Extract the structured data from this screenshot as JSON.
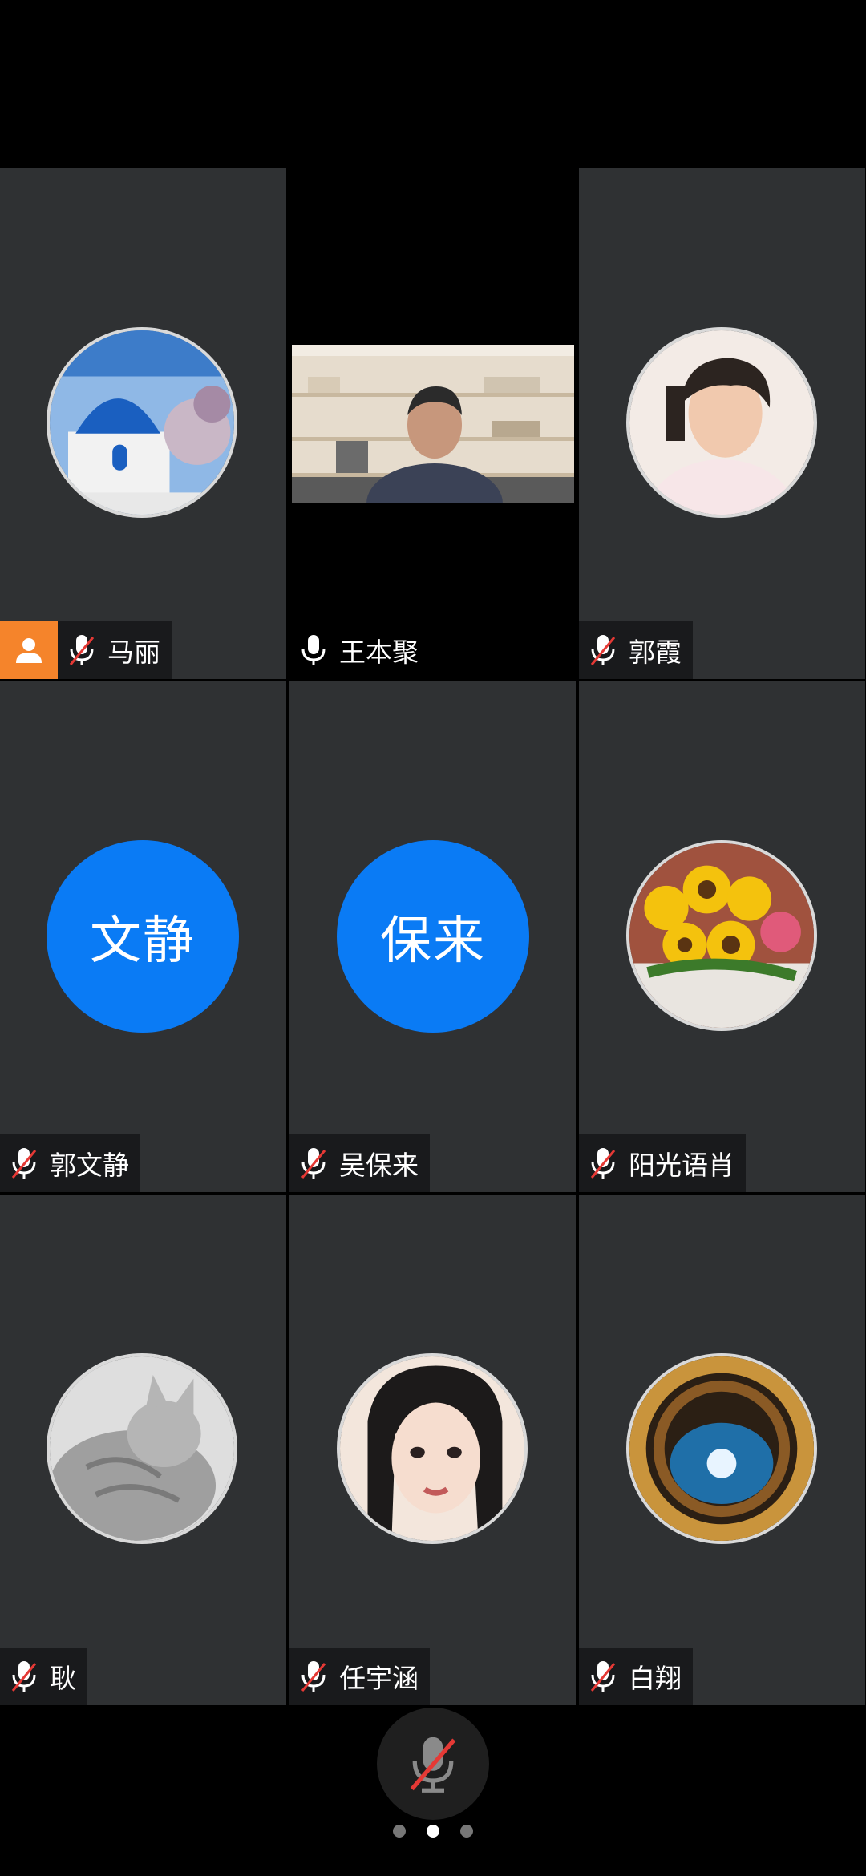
{
  "participants": [
    {
      "name": "马丽",
      "type": "avatar",
      "muted": true,
      "host": true,
      "icon": "santorini-photo"
    },
    {
      "name": "王本聚",
      "type": "video",
      "muted": false,
      "host": false
    },
    {
      "name": "郭霞",
      "type": "avatar",
      "muted": true,
      "host": false,
      "icon": "child-photo"
    },
    {
      "name": "郭文静",
      "type": "initials",
      "initials": "文静",
      "muted": true,
      "host": false
    },
    {
      "name": "吴保来",
      "type": "initials",
      "initials": "保来",
      "muted": true,
      "host": false
    },
    {
      "name": "阳光语肖",
      "type": "avatar",
      "muted": true,
      "host": false,
      "icon": "sunflowers-photo"
    },
    {
      "name": "耿",
      "type": "avatar",
      "muted": true,
      "host": false,
      "icon": "cat-photo"
    },
    {
      "name": "任宇涵",
      "type": "avatar",
      "muted": true,
      "host": false,
      "icon": "portrait-photo"
    },
    {
      "name": "白翔",
      "type": "avatar",
      "muted": true,
      "host": false,
      "icon": "stairwell-photo"
    }
  ],
  "colors": {
    "accent_blue": "#0a7bf5",
    "host_orange": "#f5842b",
    "tile_bg": "#2f3133",
    "muted_red": "#e53935"
  },
  "pager": {
    "pages": 3,
    "current": 2
  }
}
